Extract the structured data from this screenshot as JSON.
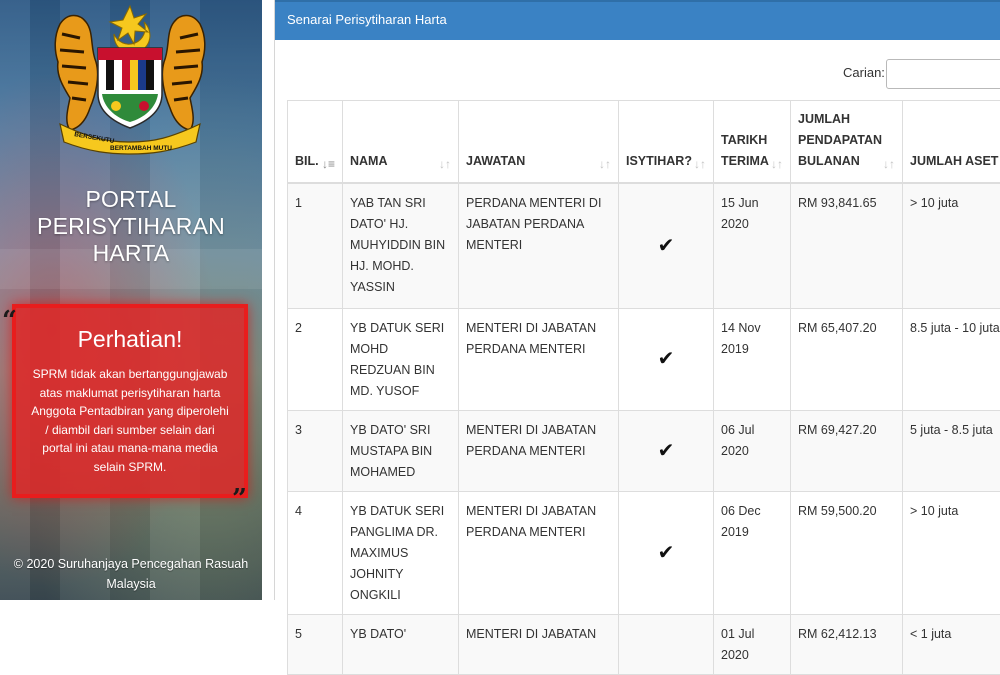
{
  "sidebar": {
    "portal_title_line1": "PORTAL PERISYTIHARAN",
    "portal_title_line2": "HARTA",
    "notice": {
      "title": "Perhatian!",
      "text": "SPRM tidak akan bertanggungjawab atas maklumat perisytiharan harta Anggota Pentadbiran yang diperolehi / diambil dari sumber selain dari portal ini atau mana-mana media selain SPRM.",
      "open_quote": "“",
      "close_quote": "”"
    },
    "copyright_line1": "© 2020 Suruhanjaya Pencegahan Rasuah",
    "copyright_line2": "Malaysia",
    "crest_motto_left": "BERSEKUTU",
    "crest_motto_bottom": "BERTAMBAH MUTU"
  },
  "panel": {
    "heading": "Senarai Perisytiharan Harta",
    "search_label": "Carian:",
    "search_value": ""
  },
  "table": {
    "headers": {
      "bil": "BIL.",
      "nama": "NAMA",
      "jawatan": "JAWATAN",
      "isytihar": "ISYTIHAR?",
      "tarikh_1": "TARIKH",
      "tarikh_2": "TERIMA",
      "pendapatan_1": "JUMLAH",
      "pendapatan_2": "PENDAPATAN",
      "pendapatan_3": "BULANAN",
      "aset": "JUMLAH ASET"
    },
    "rows": [
      {
        "bil": "1",
        "nama": "YAB TAN SRI DATO' HJ. MUHYIDDIN BIN HJ. MOHD. YASSIN",
        "jawatan": "PERDANA MENTERI DI JABATAN PERDANA MENTERI",
        "isytihar": "✔",
        "tarikh": "15 Jun 2020",
        "pendapatan": "RM 93,841.65",
        "aset": "> 10 juta"
      },
      {
        "bil": "2",
        "nama": "YB DATUK SERI MOHD REDZUAN BIN MD. YUSOF",
        "jawatan": "MENTERI DI JABATAN PERDANA MENTERI",
        "isytihar": "✔",
        "tarikh": "14 Nov 2019",
        "pendapatan": "RM 65,407.20",
        "aset": "8.5 juta - 10 juta"
      },
      {
        "bil": "3",
        "nama": "YB DATO' SRI MUSTAPA BIN MOHAMED",
        "jawatan": "MENTERI DI JABATAN PERDANA MENTERI",
        "isytihar": "✔",
        "tarikh": "06 Jul 2020",
        "pendapatan": "RM 69,427.20",
        "aset": "5 juta - 8.5 juta"
      },
      {
        "bil": "4",
        "nama": "YB DATUK SERI PANGLIMA DR. MAXIMUS JOHNITY ONGKILI",
        "jawatan": "MENTERI DI JABATAN PERDANA MENTERI",
        "isytihar": "✔",
        "tarikh": "06 Dec 2019",
        "pendapatan": "RM 59,500.20",
        "aset": "> 10 juta"
      },
      {
        "bil": "5",
        "nama": "YB DATO'",
        "jawatan": "MENTERI DI JABATAN",
        "isytihar": "",
        "tarikh": "01 Jul 2020",
        "pendapatan": "RM 62,412.13",
        "aset": "< 1 juta"
      }
    ]
  },
  "colors": {
    "panel_heading": "#3a82c4",
    "notice_bg": "#de2828",
    "notice_border": "#e81d1d"
  },
  "icons": {
    "crest": "malaysia-coat-of-arms-icon",
    "sort": "sort-arrows-icon",
    "check": "checkmark-icon"
  }
}
